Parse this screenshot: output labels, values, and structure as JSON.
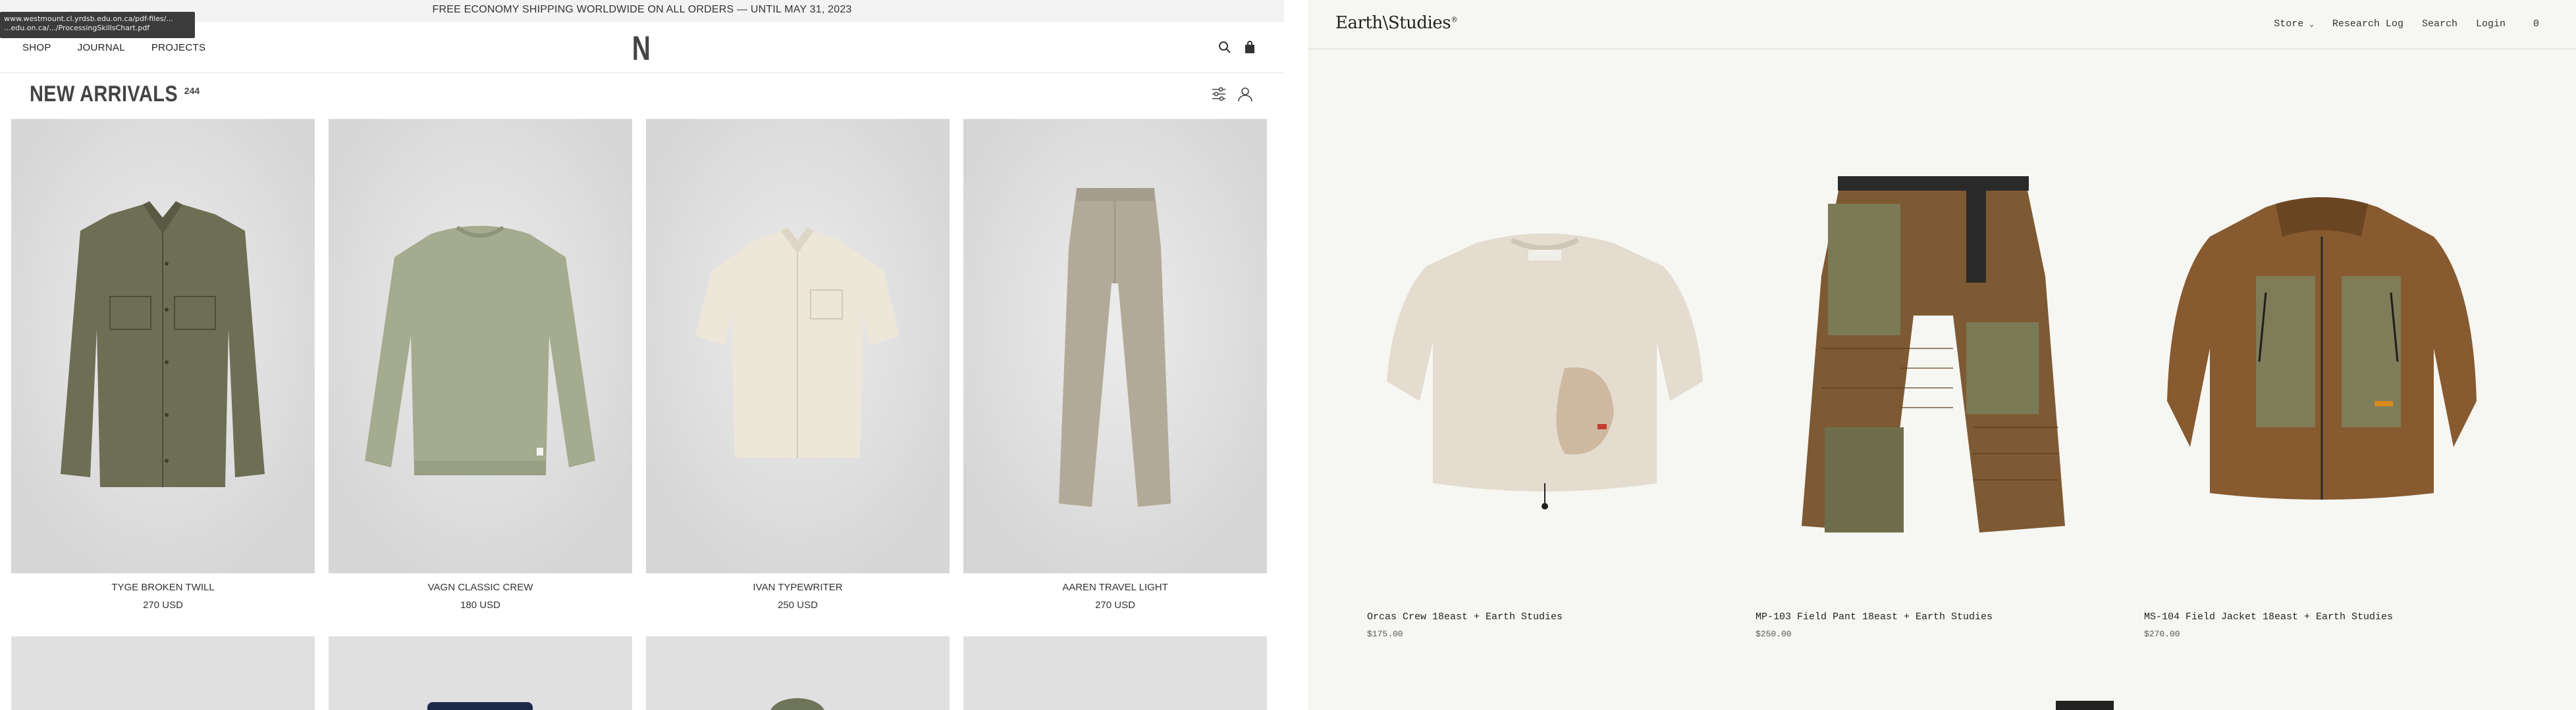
{
  "tooltip": {
    "line1": "www.westmount.cl.yrdsb.edu.on.ca/pdf-files/...",
    "line2": "...edu.on.ca/.../ProcessingSkillsChart.pdf"
  },
  "left_site": {
    "promo": "FREE ECONOMY SHIPPING WORLDWIDE ON ALL ORDERS — UNTIL MAY 31, 2023",
    "nav": [
      "SHOP",
      "JOURNAL",
      "PROJECTS"
    ],
    "logo": "N",
    "page_title": "NEW ARRIVALS",
    "count": "244",
    "products": [
      {
        "name": "TYGE BROKEN TWILL",
        "price": "270 USD"
      },
      {
        "name": "VAGN CLASSIC CREW",
        "price": "180 USD"
      },
      {
        "name": "IVAN TYPEWRITER",
        "price": "250 USD"
      },
      {
        "name": "AAREN TRAVEL LIGHT",
        "price": "270 USD"
      }
    ],
    "icons": [
      "search-icon",
      "bag-icon",
      "filter-icon",
      "account-icon"
    ]
  },
  "right_site": {
    "logo": "Earth\\Studies",
    "logo_mark": "®",
    "nav": {
      "store": "Store",
      "research": "Research Log",
      "search": "Search",
      "login": "Login",
      "cart": "0"
    },
    "products": [
      {
        "name": "Orcas Crew 18east + Earth Studies",
        "price": "$175.00"
      },
      {
        "name": "MP-103 Field Pant 18east + Earth Studies",
        "price": "$250.00"
      },
      {
        "name": "MS-104 Field Jacket 18east + Earth Studies",
        "price": "$270.00"
      }
    ]
  },
  "colors": {
    "left_bg": "#ffffff",
    "right_bg": "#f6f6f2",
    "product_bg": "#e0e0e0"
  }
}
